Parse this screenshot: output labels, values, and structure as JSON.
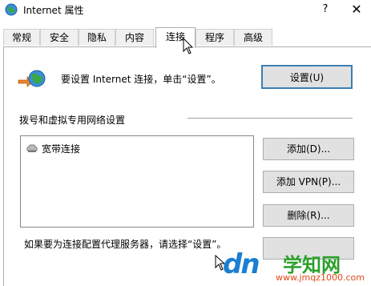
{
  "window": {
    "title": "Internet 属性",
    "help_glyph": "?",
    "close_glyph": "✕"
  },
  "tabs": [
    {
      "label": "常规"
    },
    {
      "label": "安全"
    },
    {
      "label": "隐私"
    },
    {
      "label": "内容"
    },
    {
      "label": "连接",
      "active": true
    },
    {
      "label": "程序"
    },
    {
      "label": "高级"
    }
  ],
  "setup": {
    "text": "要设置 Internet 连接，单击“设置”。",
    "button": "设置(U)"
  },
  "dialup": {
    "section_label": "拨号和虚拟专用网络设置",
    "items": [
      {
        "label": "宽带连接",
        "icon": "broadband-connection-icon"
      }
    ],
    "add_button": "添加(D)...",
    "add_vpn_button": "添加 VPN(P)...",
    "delete_button": "删除(R)..."
  },
  "proxy": {
    "text": "如果要为连接配置代理服务器，请选择“设置”。"
  },
  "watermark": {
    "logo": "dn",
    "title": "学知网",
    "url": "www.jmqz1000.com"
  },
  "colors": {
    "accent": "#3c7fb1",
    "button_bg": "#e1e1e1",
    "watermark_blue": "#1a7fd1",
    "watermark_green": "#2aa02a",
    "watermark_red": "#e04a1a"
  }
}
